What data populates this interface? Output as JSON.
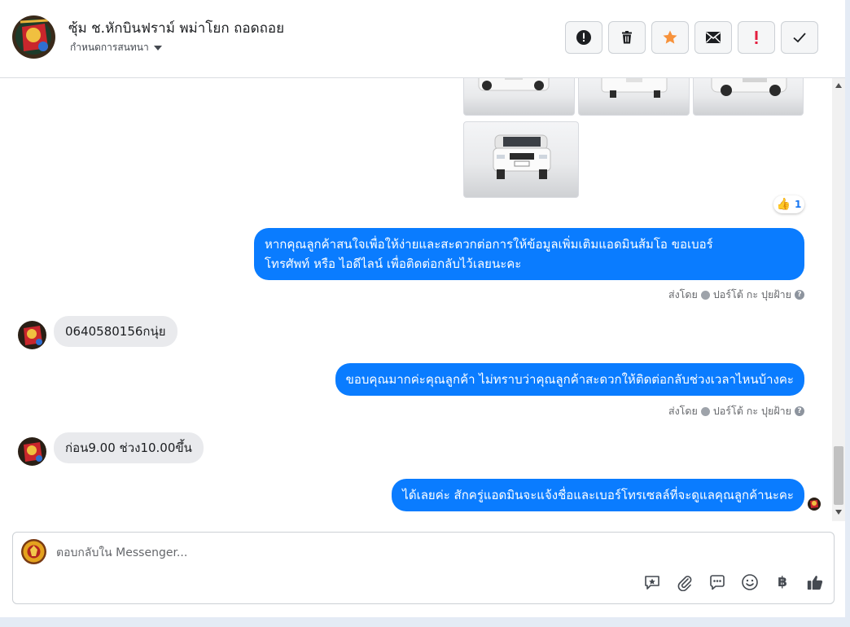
{
  "header": {
    "name": "ซุ้ม ช.หักบินฟราม์ พม่าโยก ถอดถอย",
    "subtitle": "กำหนดการสนทนา",
    "actions": [
      {
        "name": "report-button",
        "icon": "alert-circle-icon"
      },
      {
        "name": "delete-button",
        "icon": "trash-icon"
      },
      {
        "name": "star-button",
        "icon": "star-icon"
      },
      {
        "name": "mark-unread-button",
        "icon": "mail-icon"
      },
      {
        "name": "spam-button",
        "icon": "exclamation-icon"
      },
      {
        "name": "done-button",
        "icon": "check-icon"
      }
    ]
  },
  "thread": {
    "reaction": {
      "icon": "thumbs-up-icon",
      "count": "1"
    },
    "messages": [
      {
        "direction": "out",
        "text_line1": "หากคุณลูกค้าสนใจเพื่อให้ง่ายและสะดวกต่อการให้ข้อมูลเพิ่มเติมแอดมินส้มโอ ขอเบอร์",
        "text_line2": "โทรศัพท์ หรือ ไอดีไลน์ เพื่อติดต่อกลับไว้เลยนะคะ",
        "sent_by_label": "ส่งโดย",
        "sender": "ปอร์โต้ กะ ปุยฝ้าย"
      },
      {
        "direction": "in",
        "text": "0640580156กนุ่ย"
      },
      {
        "direction": "out",
        "text": "ขอบคุณมากค่ะคุณลูกค้า ไม่ทราบว่าคุณลูกค้าสะดวกให้ติดต่อกลับช่วงเวลาไหนบ้างคะ",
        "sent_by_label": "ส่งโดย",
        "sender": "ปอร์โต้ กะ ปุยฝ้าย"
      },
      {
        "direction": "in",
        "text": "ก่อน9.00  ช่วง10.00ขึ้น"
      },
      {
        "direction": "out",
        "text": "ได้เลยค่ะ สักครู่แอดมินจะแจ้งชื่อและเบอร์โทรเซลล์ที่จะดูแลคุณลูกค้านะคะ"
      }
    ]
  },
  "composer": {
    "placeholder": "ตอบกลับใน Messenger...",
    "tools": [
      "saved-reply-icon",
      "attachment-icon",
      "chat-bubble-icon",
      "emoji-icon",
      "baht-icon",
      "thumbs-up-icon"
    ]
  },
  "colors": {
    "outgoing_bubble": "#0a7cff",
    "incoming_bubble": "#e9eaed",
    "star": "#f7923b",
    "spam": "#e41e3f"
  }
}
